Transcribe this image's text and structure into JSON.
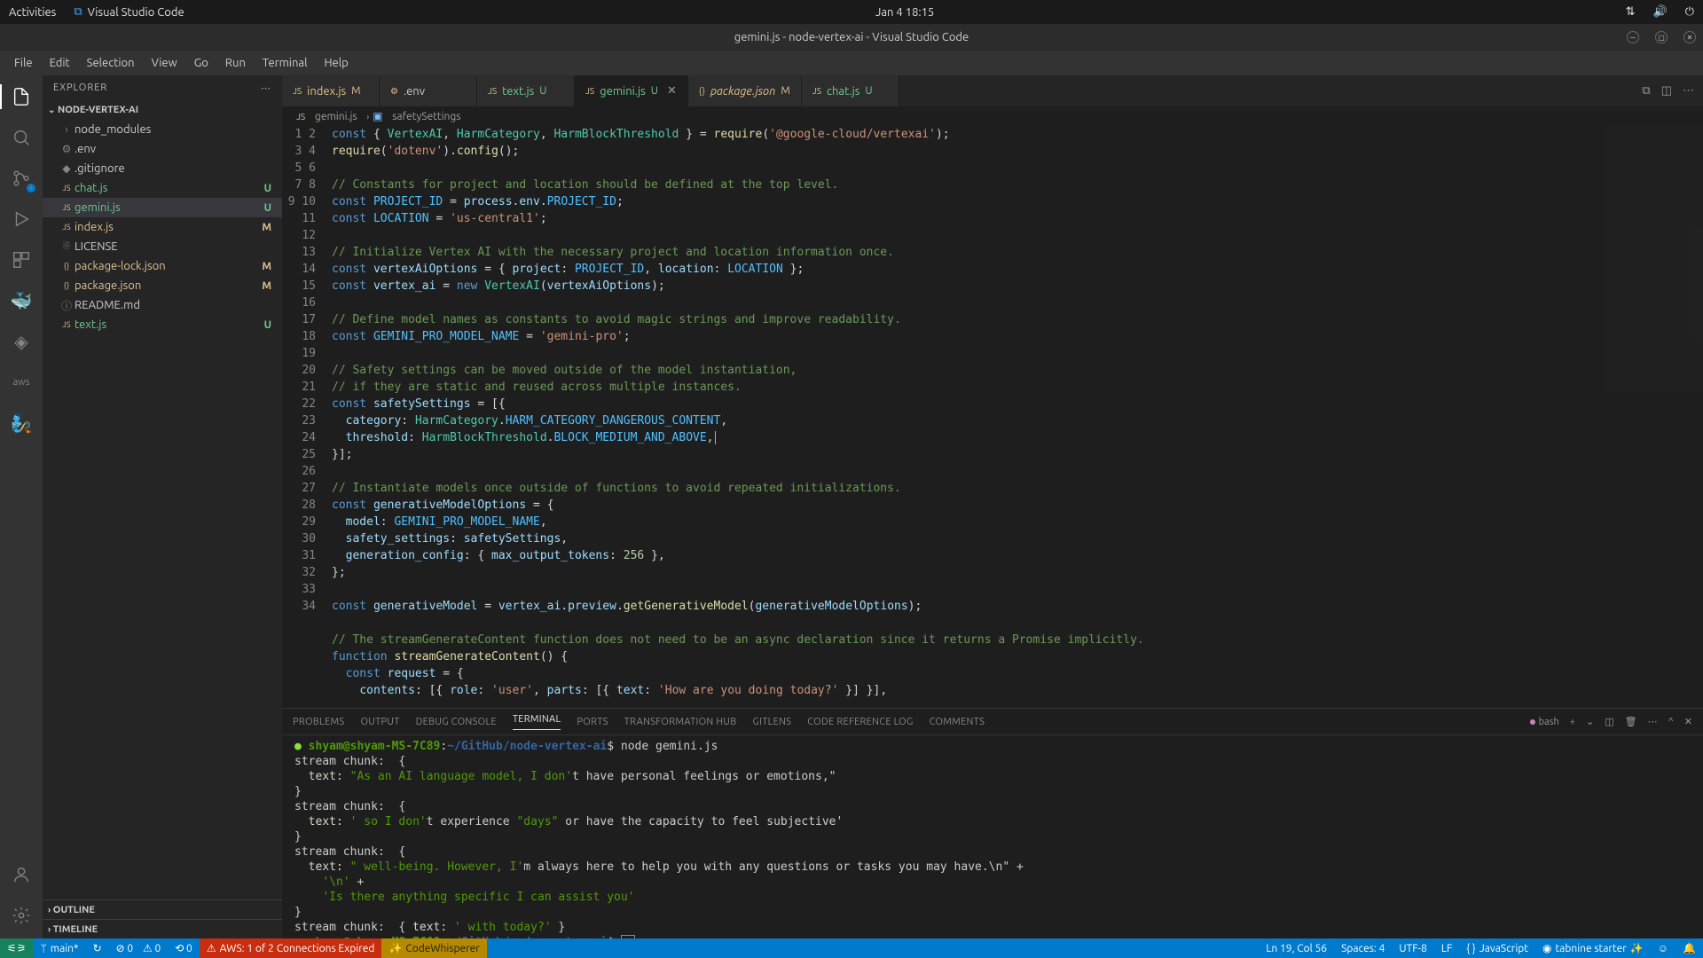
{
  "gnome": {
    "activities": "Activities",
    "app": "Visual Studio Code",
    "clock": "Jan 4  18:15"
  },
  "titlebar": "gemini.js - node-vertex-ai - Visual Studio Code",
  "menubar": [
    "File",
    "Edit",
    "Selection",
    "View",
    "Go",
    "Run",
    "Terminal",
    "Help"
  ],
  "sidebar": {
    "title": "EXPLORER",
    "project": "NODE-VERTEX-AI",
    "files": [
      {
        "icon": "›",
        "label": "node_modules",
        "status": "",
        "cls": ""
      },
      {
        "icon": "⚙",
        "label": ".env",
        "status": "",
        "cls": ""
      },
      {
        "icon": "◆",
        "label": ".gitignore",
        "status": "",
        "cls": ""
      },
      {
        "icon": "JS",
        "label": "chat.js",
        "status": "U",
        "cls": "git-u-text"
      },
      {
        "icon": "JS",
        "label": "gemini.js",
        "status": "U",
        "cls": "git-u-text",
        "selected": true
      },
      {
        "icon": "JS",
        "label": "index.js",
        "status": "M",
        "cls": "git-m-text"
      },
      {
        "icon": "🗎",
        "label": "LICENSE",
        "status": "",
        "cls": ""
      },
      {
        "icon": "{}",
        "label": "package-lock.json",
        "status": "M",
        "cls": "git-m-text"
      },
      {
        "icon": "{}",
        "label": "package.json",
        "status": "M",
        "cls": "git-m-text"
      },
      {
        "icon": "ⓘ",
        "label": "README.md",
        "status": "",
        "cls": ""
      },
      {
        "icon": "JS",
        "label": "text.js",
        "status": "U",
        "cls": "git-u-text"
      }
    ],
    "outline": "OUTLINE",
    "timeline": "TIMELINE"
  },
  "tabs": [
    {
      "icon": "JS",
      "label": "index.js",
      "status": "M",
      "statusCls": "git-m"
    },
    {
      "icon": "⚙",
      "label": ".env",
      "status": "",
      "statusCls": ""
    },
    {
      "icon": "JS",
      "label": "text.js",
      "status": "U",
      "statusCls": "git-u"
    },
    {
      "icon": "JS",
      "label": "gemini.js",
      "status": "U",
      "statusCls": "git-u",
      "active": true,
      "close": true
    },
    {
      "icon": "{}",
      "label": "package.json",
      "status": "M",
      "statusCls": "git-m",
      "italic": true
    },
    {
      "icon": "JS",
      "label": "chat.js",
      "status": "U",
      "statusCls": "git-u"
    }
  ],
  "breadcrumbs": {
    "file": "gemini.js",
    "symbol": "safetySettings"
  },
  "code_lines": 34,
  "panel": {
    "tabs": [
      "PROBLEMS",
      "OUTPUT",
      "DEBUG CONSOLE",
      "TERMINAL",
      "PORTS",
      "TRANSFORMATION HUB",
      "GITLENS",
      "CODE REFERENCE LOG",
      "COMMENTS"
    ],
    "active": 3,
    "shell": "bash",
    "prompt_user": "shyam@shyam-MS-7C89",
    "prompt_path": "~/GitHub/node-vertex-ai",
    "command": "node gemini.js",
    "output_lines": [
      "stream chunk:  {",
      "  text: \"As an AI language model, I don't have personal feelings or emotions,\"",
      "}",
      "stream chunk:  {",
      "  text: ' so I don't experience \"days\" or have the capacity to feel subjective'",
      "}",
      "stream chunk:  {",
      "  text: \" well-being. However, I'm always here to help you with any questions or tasks you may have.\\n\" +",
      "    '\\n' +",
      "    'Is there anything specific I can assist you'",
      "}",
      "stream chunk:  { text: ' with today?' }"
    ]
  },
  "status": {
    "branch": "main*",
    "sync": "↻",
    "errors": "⊘ 0",
    "warnings": "⚠ 0",
    "port": "⟲ 0",
    "aws": "AWS: 1 of 2 Connections Expired",
    "codewhisperer": "CodeWhisperer",
    "pos": "Ln 19, Col 56",
    "spaces": "Spaces: 4",
    "enc": "UTF-8",
    "eol": "LF",
    "lang": "JavaScript",
    "tabnine": "tabnine starter",
    "bell": "🔔"
  }
}
